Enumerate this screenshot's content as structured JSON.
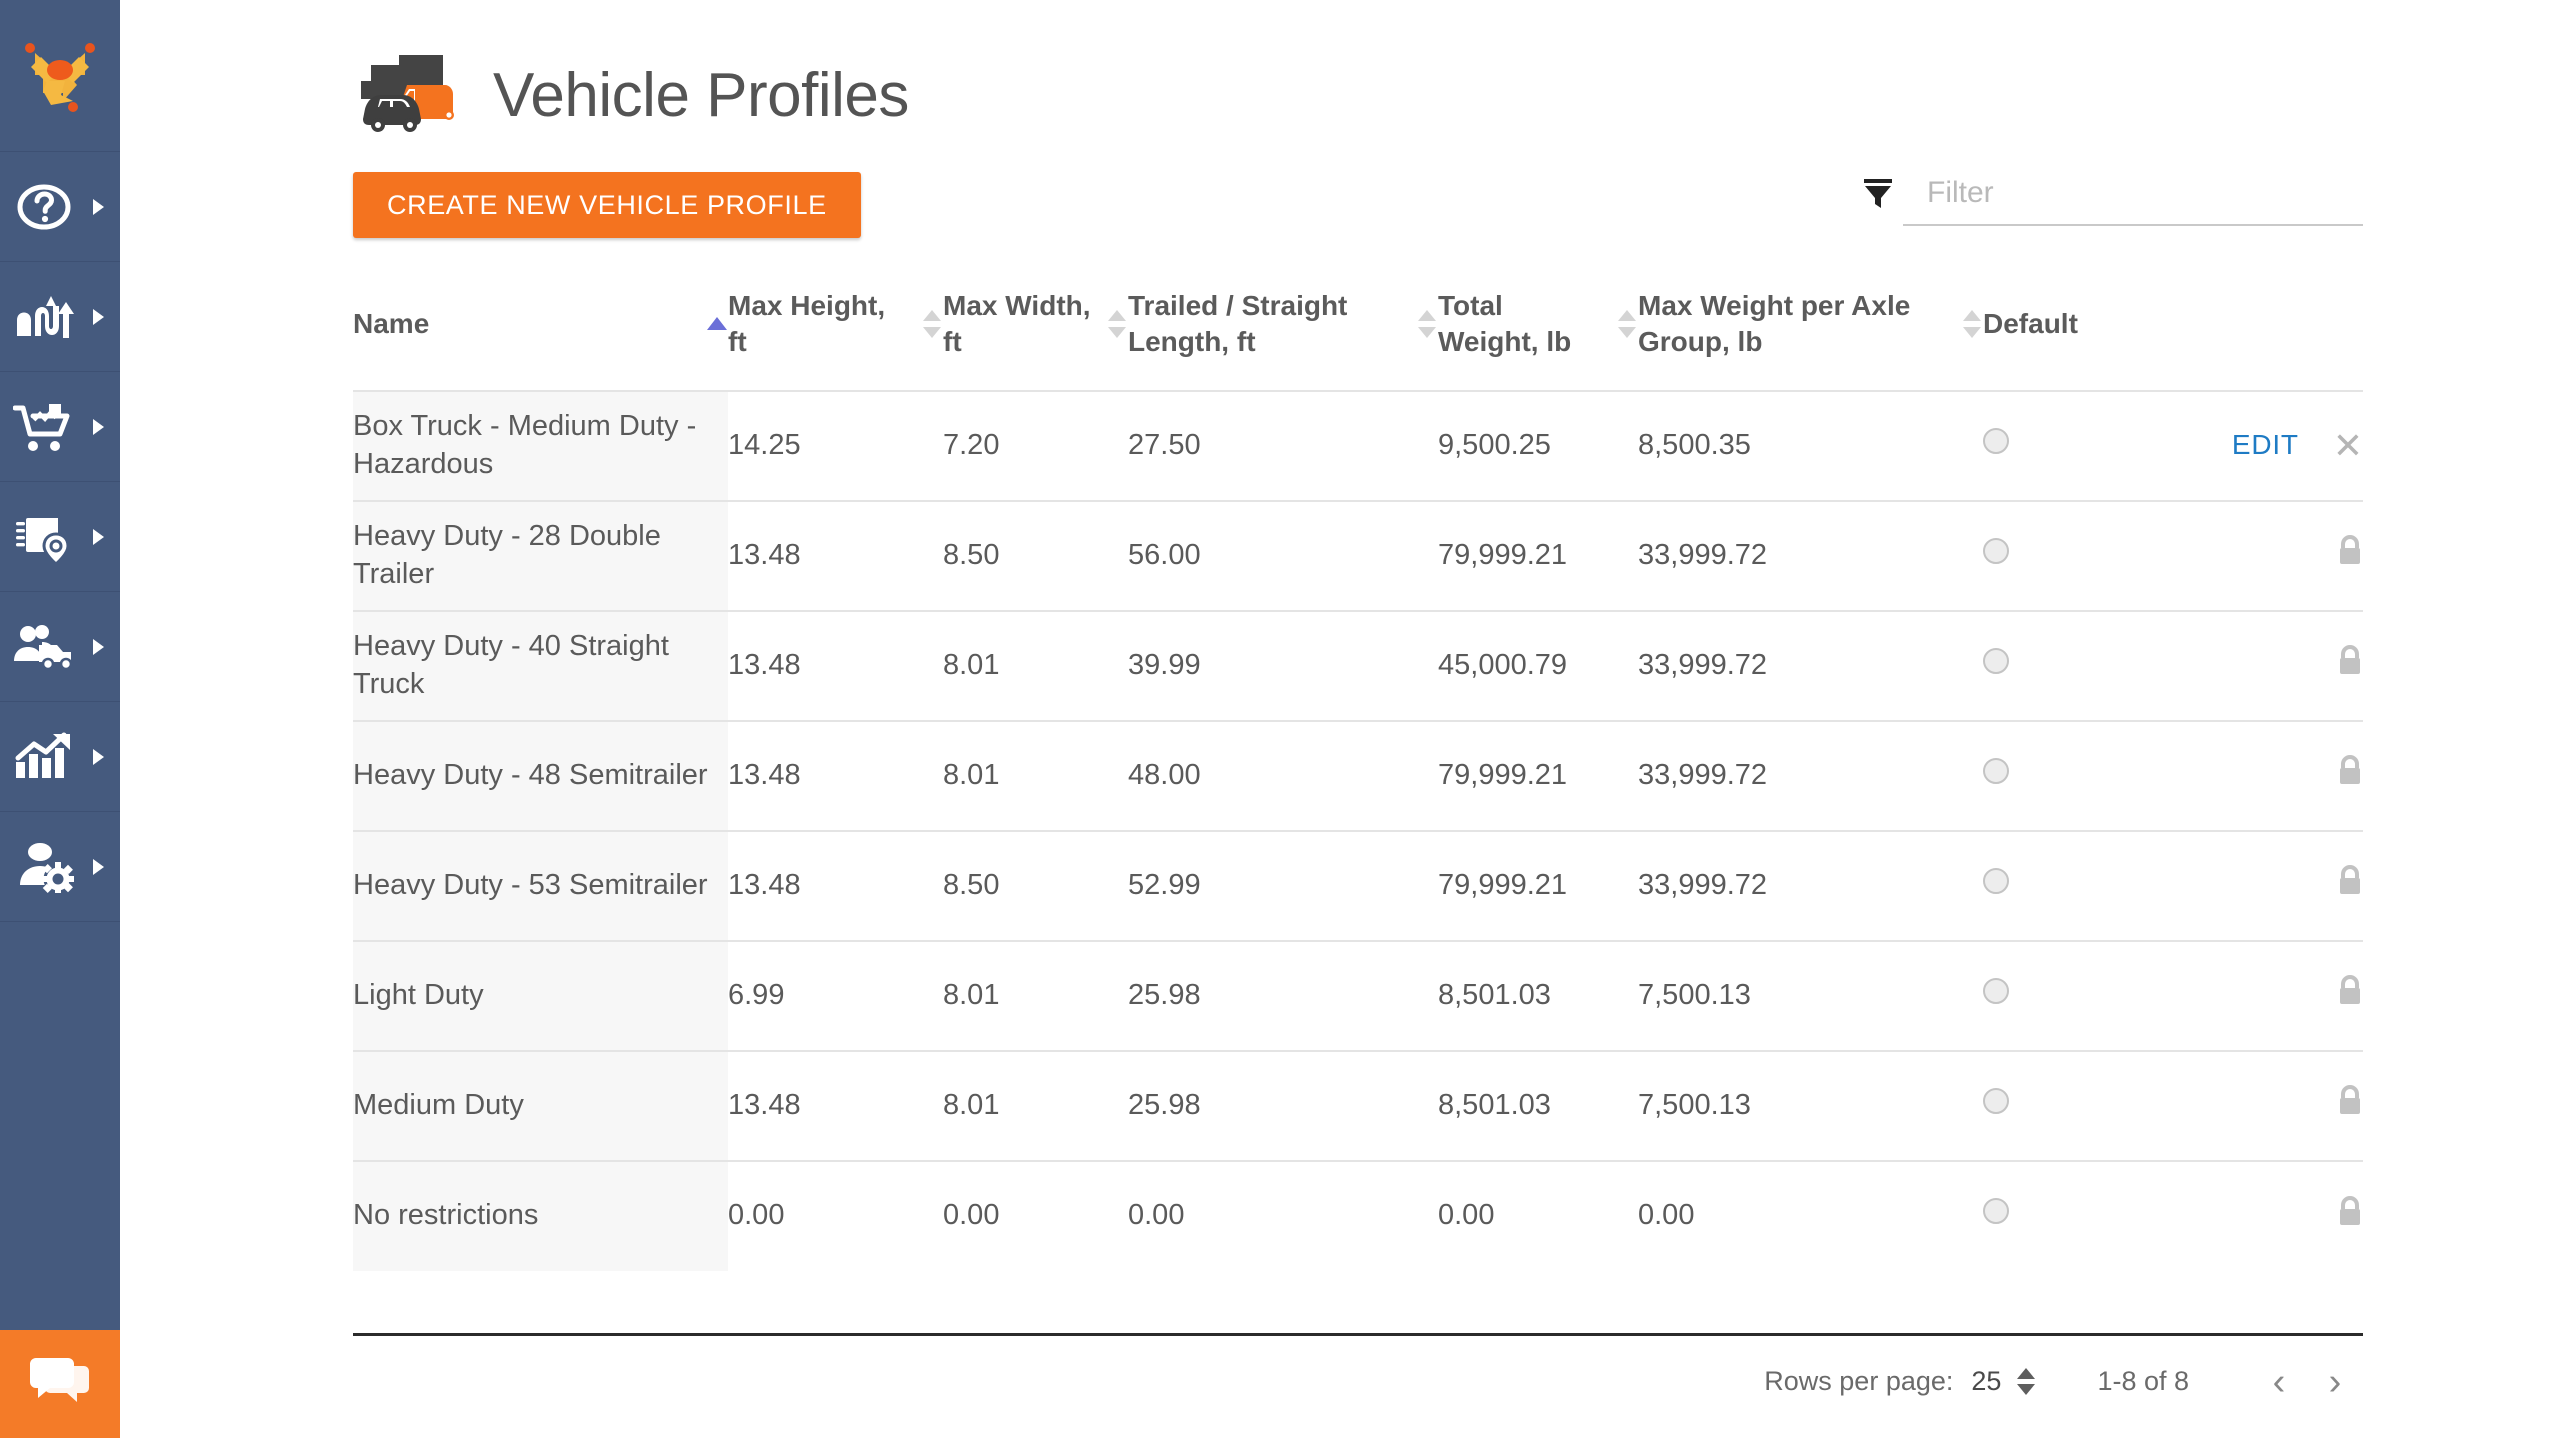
{
  "sidebar": {
    "logo_name": "route-arrows-logo",
    "items": [
      {
        "name": "help",
        "icon": "question-circle-icon",
        "caret": true
      },
      {
        "name": "routes",
        "icon": "routes-arrows-icon",
        "caret": true
      },
      {
        "name": "orders",
        "icon": "shopping-cart-icon",
        "caret": true
      },
      {
        "name": "territories",
        "icon": "map-pin-notebook-icon",
        "caret": true
      },
      {
        "name": "drivers",
        "icon": "team-truck-icon",
        "caret": true
      },
      {
        "name": "analytics",
        "icon": "bar-chart-growth-icon",
        "caret": true
      },
      {
        "name": "admin",
        "icon": "user-gear-icon",
        "caret": true
      }
    ],
    "chat": {
      "name": "chat-bubble",
      "icon": "chat-bubbles-icon"
    }
  },
  "header": {
    "title": "Vehicle Profiles",
    "icon": "vehicles-truck-van-car-icon"
  },
  "toolbar": {
    "create_label": "CREATE NEW VEHICLE PROFILE",
    "filter_placeholder": "Filter",
    "filter_value": "",
    "filter_icon": "funnel-filter-icon"
  },
  "table": {
    "columns": [
      {
        "key": "name",
        "label": "Name",
        "sortable": true,
        "sort": "asc"
      },
      {
        "key": "max_height",
        "label": "Max Height, ft",
        "sortable": true,
        "sort": "none"
      },
      {
        "key": "max_width",
        "label": "Max Width, ft",
        "sortable": true,
        "sort": "none"
      },
      {
        "key": "length",
        "label": "Trailed / Straight Length, ft",
        "sortable": true,
        "sort": "none"
      },
      {
        "key": "total_weight",
        "label": "Total Weight, lb",
        "sortable": true,
        "sort": "none"
      },
      {
        "key": "axle_weight",
        "label": "Max Weight per Axle Group, lb",
        "sortable": true,
        "sort": "none"
      },
      {
        "key": "default",
        "label": "Default",
        "sortable": false,
        "sort": "none"
      }
    ],
    "rows": [
      {
        "name": "Box Truck - Medium Duty - Hazardous",
        "max_height": "14.25",
        "max_width": "7.20",
        "length": "27.50",
        "total_weight": "9,500.25",
        "axle_weight": "8,500.35",
        "is_default": false,
        "locked": false,
        "edit_label": "EDIT",
        "delete_icon": "close-x-icon"
      },
      {
        "name": "Heavy Duty - 28 Double Trailer",
        "max_height": "13.48",
        "max_width": "8.50",
        "length": "56.00",
        "total_weight": "79,999.21",
        "axle_weight": "33,999.72",
        "is_default": false,
        "locked": true,
        "lock_icon": "lock-icon"
      },
      {
        "name": "Heavy Duty - 40 Straight Truck",
        "max_height": "13.48",
        "max_width": "8.01",
        "length": "39.99",
        "total_weight": "45,000.79",
        "axle_weight": "33,999.72",
        "is_default": false,
        "locked": true,
        "lock_icon": "lock-icon"
      },
      {
        "name": "Heavy Duty - 48 Semitrailer",
        "max_height": "13.48",
        "max_width": "8.01",
        "length": "48.00",
        "total_weight": "79,999.21",
        "axle_weight": "33,999.72",
        "is_default": false,
        "locked": true,
        "lock_icon": "lock-icon"
      },
      {
        "name": "Heavy Duty - 53 Semitrailer",
        "max_height": "13.48",
        "max_width": "8.50",
        "length": "52.99",
        "total_weight": "79,999.21",
        "axle_weight": "33,999.72",
        "is_default": false,
        "locked": true,
        "lock_icon": "lock-icon"
      },
      {
        "name": "Light Duty",
        "max_height": "6.99",
        "max_width": "8.01",
        "length": "25.98",
        "total_weight": "8,501.03",
        "axle_weight": "7,500.13",
        "is_default": false,
        "locked": true,
        "lock_icon": "lock-icon"
      },
      {
        "name": "Medium Duty",
        "max_height": "13.48",
        "max_width": "8.01",
        "length": "25.98",
        "total_weight": "8,501.03",
        "axle_weight": "7,500.13",
        "is_default": false,
        "locked": true,
        "lock_icon": "lock-icon"
      },
      {
        "name": "No restrictions",
        "max_height": "0.00",
        "max_width": "0.00",
        "length": "0.00",
        "total_weight": "0.00",
        "axle_weight": "0.00",
        "is_default": false,
        "locked": true,
        "lock_icon": "lock-icon"
      }
    ]
  },
  "pagination": {
    "rows_per_page_label": "Rows per page:",
    "rows_per_page_value": "25",
    "range": "1-8 of 8",
    "prev": "‹",
    "next": "›"
  },
  "colors": {
    "sidebar": "#455A7E",
    "accent_orange": "#F4731F",
    "chat_orange": "#F47B28",
    "link_blue": "#1E7BC4",
    "sort_active": "#6B6FD8",
    "name_cell_bg": "#F7F7F7",
    "text": "#5a5a5a"
  }
}
